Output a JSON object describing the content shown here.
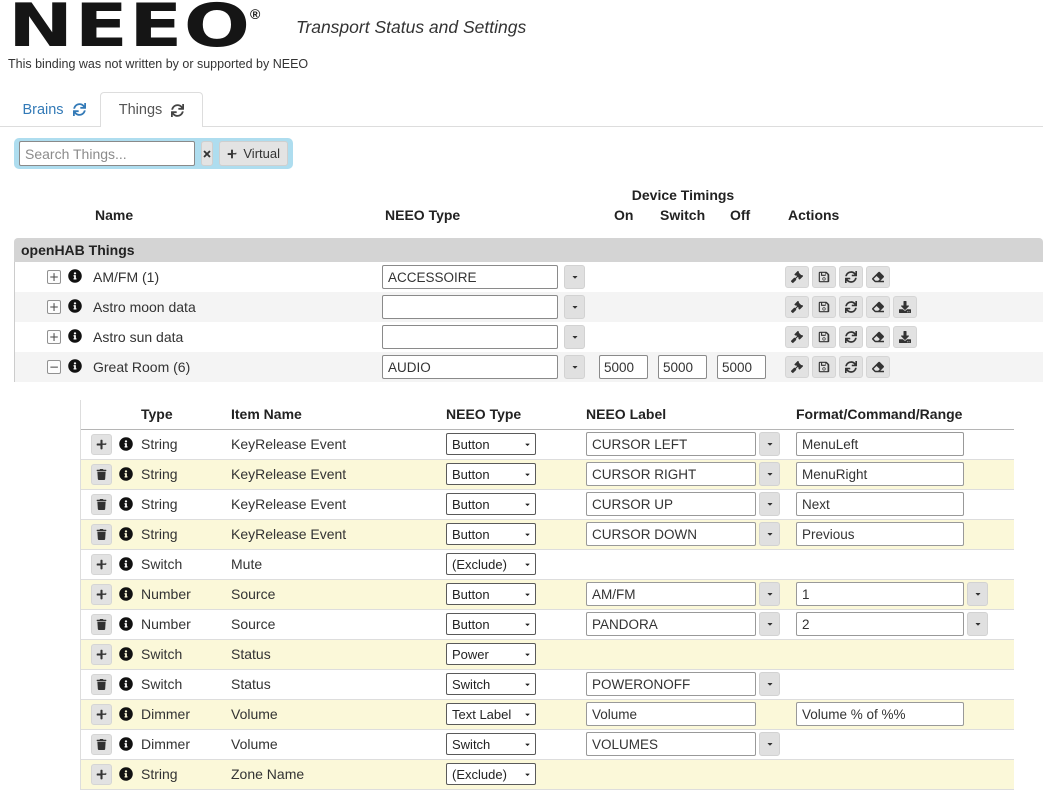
{
  "header": {
    "logo_text": "NEEO",
    "registered_mark": "®",
    "subtitle": "Transport Status and Settings",
    "disclaimer": "This binding was not written by or supported by NEEO"
  },
  "tabs": {
    "brains_label": "Brains",
    "things_label": "Things"
  },
  "search": {
    "placeholder": "Search Things...",
    "virtual_label": "Virtual"
  },
  "icons": {
    "refresh": "circular-arrows",
    "clear": "times-x",
    "add": "plus",
    "info": "info-circle",
    "expand": "plus-box",
    "collapse": "minus-box",
    "caret": "caret-down-triangle",
    "actions": [
      "gavel",
      "save-floppy",
      "refresh",
      "eraser",
      "download"
    ],
    "delete": "trash-can"
  },
  "colors": {
    "accent_blue": "#337ab7",
    "panel_blue": "#aeddef",
    "stripe_gray": "#f4f4f4",
    "stripe_yellow": "#fbf8d9",
    "group_bar_gray": "#d4d4d4",
    "button_gray": "#e2e2e2"
  },
  "things_table": {
    "group_header": "openHAB Things",
    "columns": {
      "name": "Name",
      "neeo_type": "NEEO Type",
      "device_timings": "Device Timings",
      "on": "On",
      "switch": "Switch",
      "off": "Off",
      "actions": "Actions"
    },
    "rows": [
      {
        "expand": "+",
        "name": "AM/FM (1)",
        "neeo_type": "ACCESSOIRE",
        "actions": [
          "gavel",
          "save",
          "refresh",
          "eraser"
        ]
      },
      {
        "expand": "+",
        "name": "Astro moon data",
        "neeo_type": "",
        "actions": [
          "gavel",
          "save",
          "refresh",
          "eraser",
          "download"
        ]
      },
      {
        "expand": "+",
        "name": "Astro sun data",
        "neeo_type": "",
        "actions": [
          "gavel",
          "save",
          "refresh",
          "eraser",
          "download"
        ]
      },
      {
        "expand": "−",
        "name": "Great Room (6)",
        "neeo_type": "AUDIO",
        "on": "5000",
        "switch": "5000",
        "off": "5000",
        "actions": [
          "gavel",
          "save",
          "refresh",
          "eraser"
        ]
      }
    ]
  },
  "channels_table": {
    "columns": {
      "type": "Type",
      "item_name": "Item Name",
      "neeo_type": "NEEO Type",
      "neeo_label": "NEEO Label",
      "format": "Format/Command/Range"
    },
    "rows": [
      {
        "action": "add",
        "type": "String",
        "item_name": "KeyRelease Event",
        "neeo_type": "Button",
        "neeo_label": "CURSOR LEFT",
        "format": "MenuLeft"
      },
      {
        "action": "delete",
        "type": "String",
        "item_name": "KeyRelease Event",
        "neeo_type": "Button",
        "neeo_label": "CURSOR RIGHT",
        "format": "MenuRight"
      },
      {
        "action": "delete",
        "type": "String",
        "item_name": "KeyRelease Event",
        "neeo_type": "Button",
        "neeo_label": "CURSOR UP",
        "format": "Next"
      },
      {
        "action": "delete",
        "type": "String",
        "item_name": "KeyRelease Event",
        "neeo_type": "Button",
        "neeo_label": "CURSOR DOWN",
        "format": "Previous"
      },
      {
        "action": "add",
        "type": "Switch",
        "item_name": "Mute",
        "neeo_type": "(Exclude)"
      },
      {
        "action": "add",
        "type": "Number",
        "item_name": "Source",
        "neeo_type": "Button",
        "neeo_label": "AM/FM",
        "format": "1"
      },
      {
        "action": "delete",
        "type": "Number",
        "item_name": "Source",
        "neeo_type": "Button",
        "neeo_label": "PANDORA",
        "format": "2"
      },
      {
        "action": "add",
        "type": "Switch",
        "item_name": "Status",
        "neeo_type": "Power"
      },
      {
        "action": "delete",
        "type": "Switch",
        "item_name": "Status",
        "neeo_type": "Switch",
        "neeo_label": "POWERONOFF"
      },
      {
        "action": "add",
        "type": "Dimmer",
        "item_name": "Volume",
        "neeo_type": "Text Label",
        "neeo_label": "Volume",
        "format": "Volume % of %%"
      },
      {
        "action": "delete",
        "type": "Dimmer",
        "item_name": "Volume",
        "neeo_type": "Switch",
        "neeo_label": "VOLUMES"
      },
      {
        "action": "add",
        "type": "String",
        "item_name": "Zone Name",
        "neeo_type": "(Exclude)"
      }
    ]
  }
}
